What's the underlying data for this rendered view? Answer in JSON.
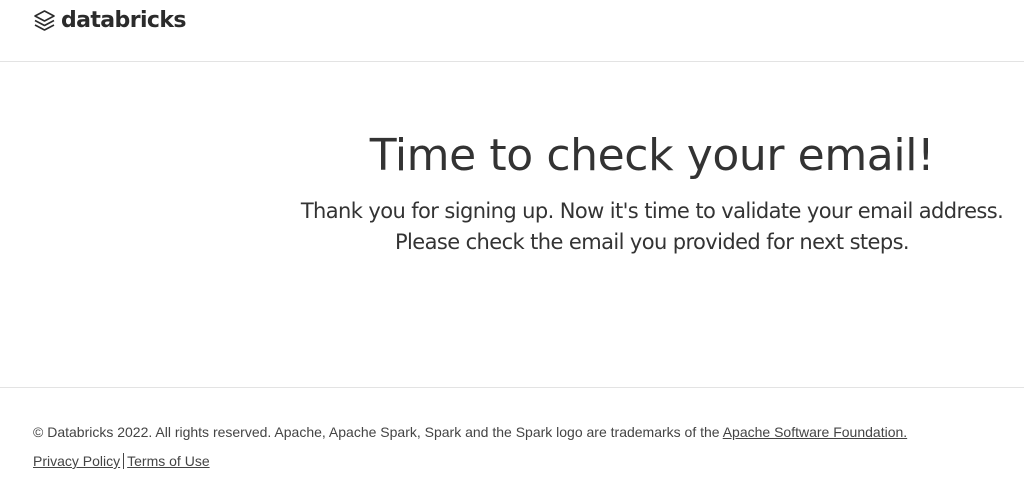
{
  "header": {
    "logo_text": "databricks",
    "logo_icon": "databricks-stack-icon"
  },
  "main": {
    "headline": "Time to check your email!",
    "subtext_line1": "Thank you for signing up. Now it's time to validate your email address.",
    "subtext_line2": "Please check the email you provided for next steps."
  },
  "footer": {
    "copyright_text": "© Databricks 2022. All rights reserved. Apache, Apache Spark, Spark and the Spark logo are trademarks of the ",
    "asf_link": "Apache Software Foundation.",
    "privacy_link": "Privacy Policy",
    "terms_link": "Terms of Use"
  },
  "colors": {
    "text": "#333333",
    "divider": "#e3e3e3",
    "logo": "#2b2b2b"
  }
}
